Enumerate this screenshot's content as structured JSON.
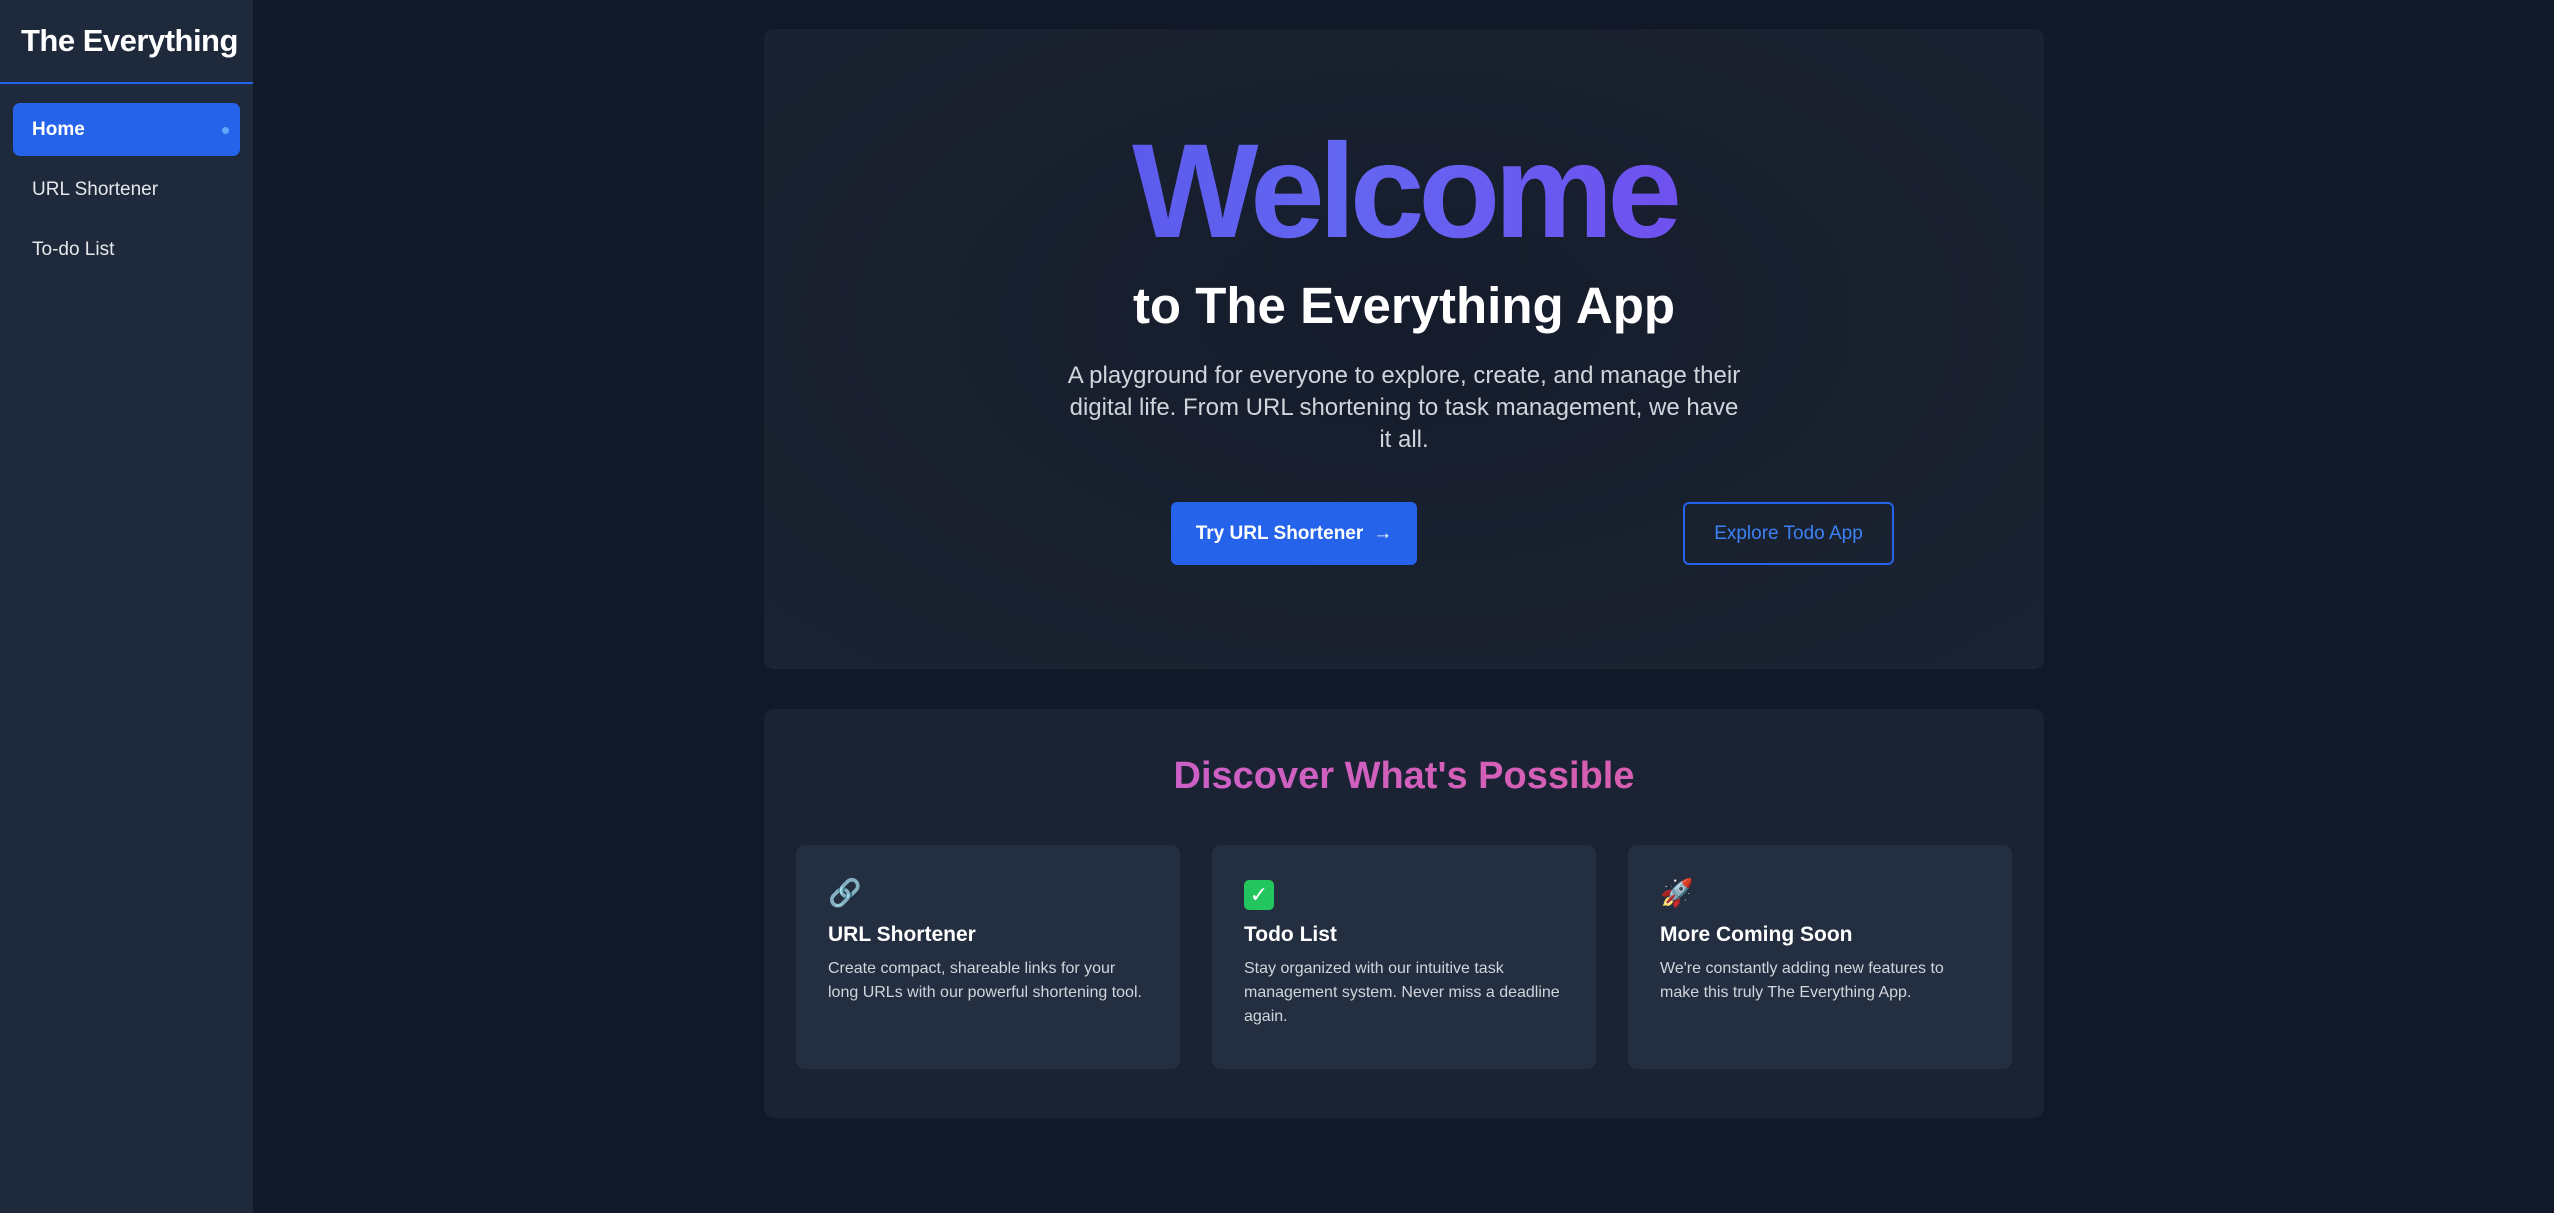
{
  "app": {
    "brand": "The Everything"
  },
  "sidebar": {
    "items": [
      {
        "label": "Home",
        "active": true
      },
      {
        "label": "URL Shortener",
        "active": false
      },
      {
        "label": "To-do List",
        "active": false
      }
    ]
  },
  "hero": {
    "title": "Welcome",
    "subtitle": "to The Everything App",
    "description": "A playground for everyone to explore, create, and manage their digital life. From URL shortening to task management, we have it all.",
    "primary_button": "Try URL Shortener",
    "primary_button_arrow": "→",
    "secondary_button": "Explore Todo App"
  },
  "discover": {
    "title": "Discover What's Possible",
    "cards": [
      {
        "icon": "link-icon",
        "icon_glyph": "🔗",
        "title": "URL Shortener",
        "text": "Create compact, shareable links for your long URLs with our powerful shortening tool."
      },
      {
        "icon": "check-icon",
        "icon_glyph": "✓",
        "title": "Todo List",
        "text": "Stay organized with our intuitive task management system. Never miss a deadline again."
      },
      {
        "icon": "rocket-icon",
        "icon_glyph": "🚀",
        "title": "More Coming Soon",
        "text": "We're constantly adding new features to make this truly The Everything App."
      }
    ]
  },
  "colors": {
    "accent": "#2563eb",
    "background": "#111827",
    "sidebar": "#1e293b",
    "card": "#232e41",
    "welcome_gradient_start": "#4f46e5",
    "welcome_gradient_end": "#7c3aed",
    "discover_gradient_start": "#c062d8",
    "discover_gradient_end": "#e060a0"
  }
}
